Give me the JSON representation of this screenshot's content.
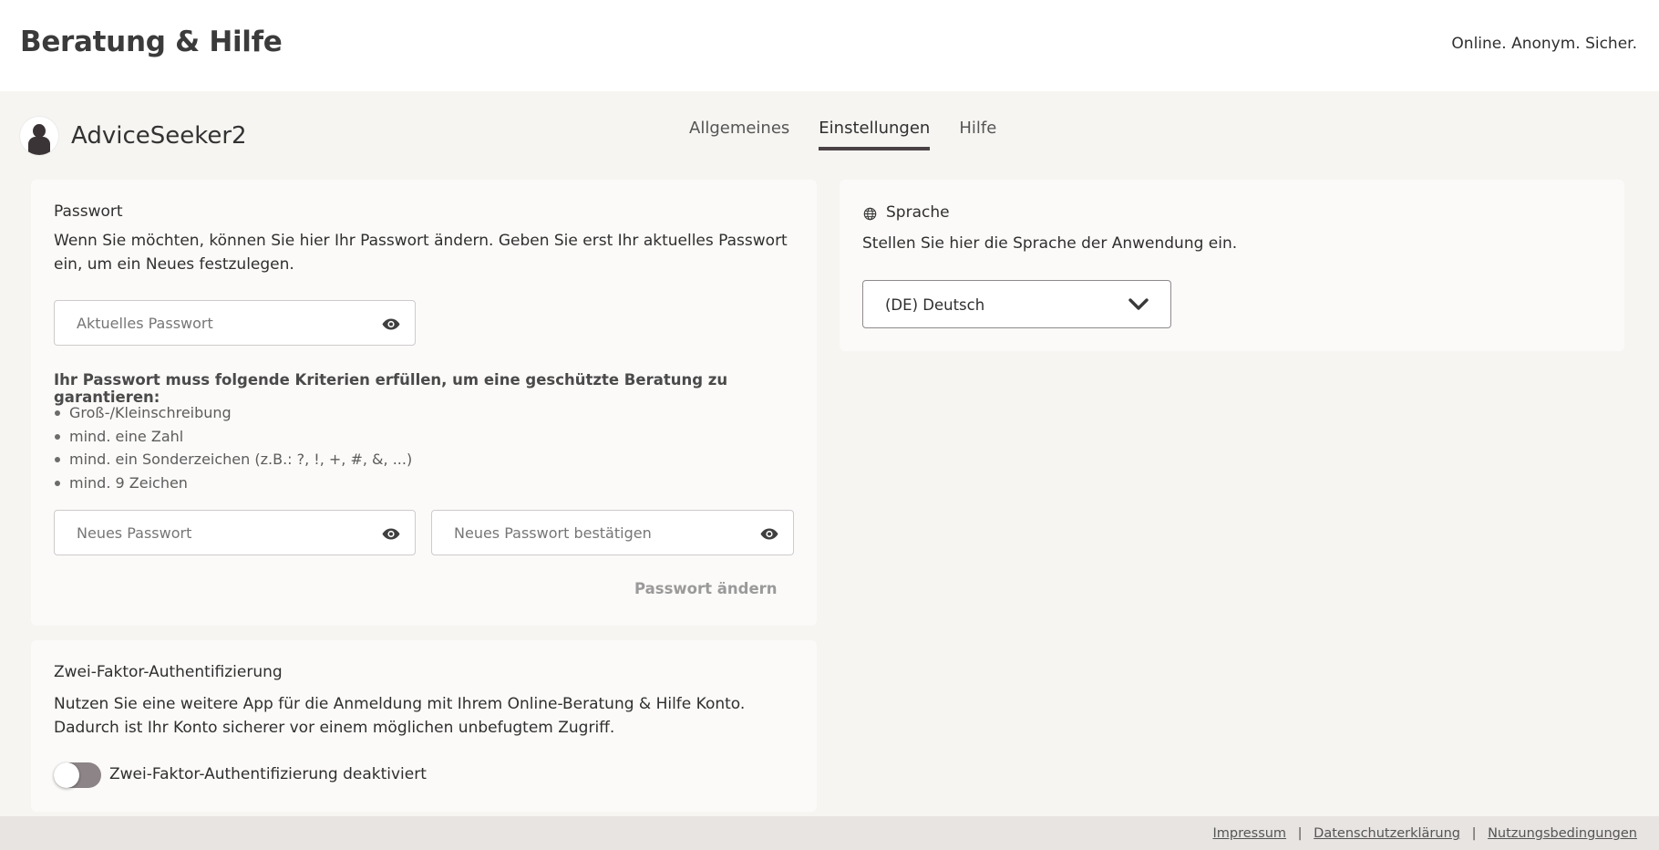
{
  "header": {
    "title": "Beratung & Hilfe",
    "tagline": "Online. Anonym. Sicher."
  },
  "profile": {
    "username": "AdviceSeeker2",
    "avatar_icon": "user-avatar-icon"
  },
  "tabs": [
    {
      "label": "Allgemeines",
      "active": false
    },
    {
      "label": "Einstellungen",
      "active": true
    },
    {
      "label": "Hilfe",
      "active": false
    }
  ],
  "password": {
    "title": "Passwort",
    "description": "Wenn Sie möchten, können Sie hier Ihr Passwort ändern. Geben Sie erst Ihr aktuelles Passwort ein, um ein Neues festzulegen.",
    "current_placeholder": "Aktuelles Passwort",
    "criteria_title": "Ihr Passwort muss folgende Kriterien erfüllen, um eine geschützte Beratung zu garantieren:",
    "criteria": [
      "Groß-/Kleinschreibung",
      "mind. eine Zahl",
      "mind. ein Sonderzeichen (z.B.: ?, !, +, #, &, ...)",
      "mind. 9 Zeichen"
    ],
    "new_placeholder": "Neues Passwort",
    "confirm_placeholder": "Neues Passwort bestätigen",
    "submit_label": "Passwort ändern",
    "eye_icon": "eye-icon"
  },
  "two_factor": {
    "title": "Zwei-Faktor-Authentifizierung",
    "description": "Nutzen Sie eine weitere App für die Anmeldung mit Ihrem Online-Beratung & Hilfe Konto. Dadurch ist Ihr Konto sicherer vor einem möglichen unbefugtem Zugriff.",
    "toggle_label": "Zwei-Faktor-Authentifizierung deaktiviert",
    "enabled": false
  },
  "language": {
    "title": "Sprache",
    "icon": "globe-icon",
    "description": "Stellen Sie hier die Sprache der Anwendung ein.",
    "selected": "(DE) Deutsch"
  },
  "footer": {
    "links": [
      "Impressum",
      "Datenschutzerklärung",
      "Nutzungsbedingungen"
    ],
    "separator": "|"
  },
  "colors": {
    "background": "#f6f5f2",
    "card": "#fbfaf8",
    "accent": "#4a4244",
    "toggle_off": "#8c8487",
    "footer": "#e7e4e2"
  }
}
